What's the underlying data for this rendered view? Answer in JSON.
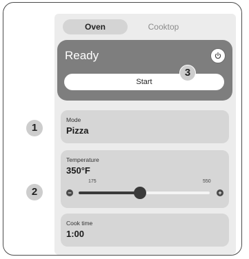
{
  "tabs": [
    {
      "label": "Oven",
      "active": true
    },
    {
      "label": "Cooktop",
      "active": false
    }
  ],
  "status": {
    "title": "Ready",
    "power_icon": "power-icon",
    "start_label": "Start"
  },
  "mode": {
    "label": "Mode",
    "value": "Pizza"
  },
  "temperature": {
    "label": "Temperature",
    "value": "350°F",
    "min_label": "175",
    "max_label": "550",
    "min": 175,
    "max": 550,
    "current": 350,
    "minus_icon": "minus-icon",
    "plus_icon": "plus-icon"
  },
  "cook_time": {
    "label": "Cook time",
    "value": "1:00"
  },
  "callouts": [
    "1",
    "2",
    "3"
  ],
  "colors": {
    "card": "#d6d6d6",
    "status_card": "#7e7e7e",
    "slider": "#3a3a3a"
  }
}
